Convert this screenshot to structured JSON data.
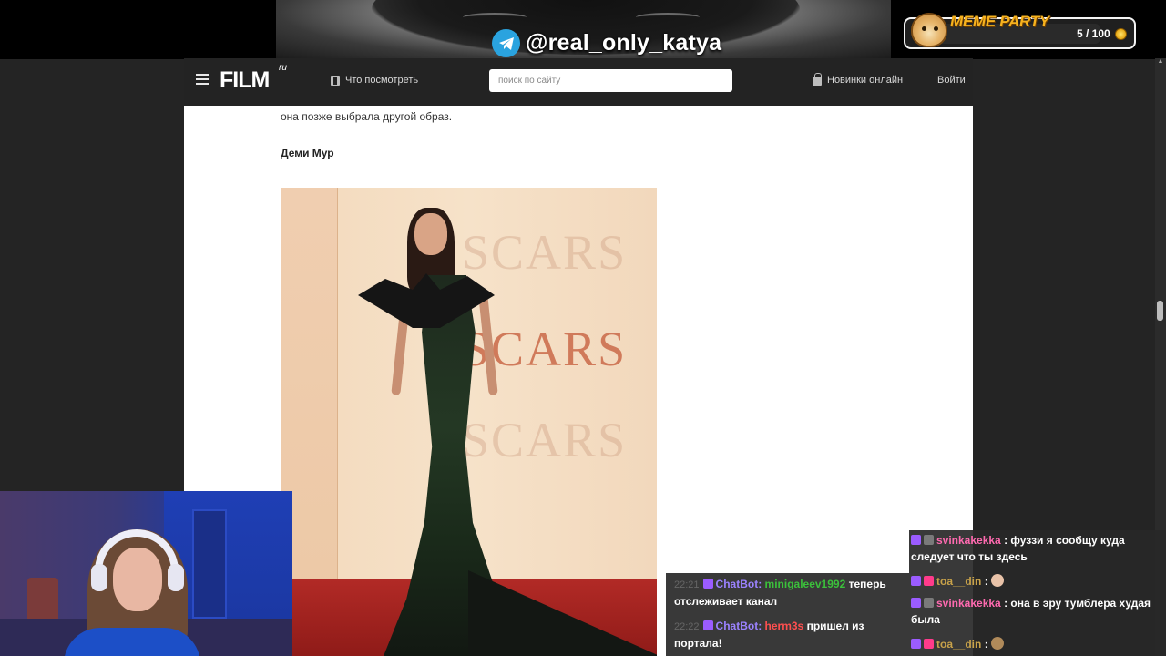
{
  "stream_overlay": {
    "telegram_handle": "@real_only_katya",
    "meme_party": {
      "title": "MEME PARTY",
      "count": "5 / 100"
    }
  },
  "site": {
    "logo": "FILM",
    "logo_suffix": "ru",
    "nav_watch": "Что посмотреть",
    "search_placeholder": "поиск по сайту",
    "nav_new": "Новинки онлайн",
    "login": "Войти"
  },
  "article": {
    "text_line": "она позже выбрала другой образ.",
    "heading": "Деми Мур",
    "photo_watermarks": [
      "SCARS",
      "SCARS",
      "SCARS"
    ]
  },
  "chat": {
    "mid": [
      {
        "time": "22:21",
        "user": "ChatBot:",
        "target": "minigaleev1992",
        "target_color": "#3bc03b",
        "text": "теперь отслеживает канал"
      },
      {
        "time": "22:22",
        "user": "ChatBot:",
        "target": "herm3s",
        "target_color": "#ff4f4f",
        "text": "пришел из портала!"
      }
    ],
    "right": [
      {
        "user": "svinkakekka",
        "user_color": "#ff6ab0",
        "sep": ":",
        "text": "фуззи я сообщу куда следует что ты здесь"
      },
      {
        "user": "toa__din",
        "user_color": "#c8a24a",
        "sep": ":",
        "text": ""
      },
      {
        "user": "svinkakekka",
        "user_color": "#ff6ab0",
        "sep": ":",
        "text": "она в эру тумблера худая была"
      },
      {
        "user": "toa__din",
        "user_color": "#c8a24a",
        "sep": ":",
        "text": ""
      }
    ]
  },
  "colors": {
    "accent_telegram": "#2aa3df",
    "meme_gold": "#f6b21e",
    "page_bg": "#242424"
  }
}
